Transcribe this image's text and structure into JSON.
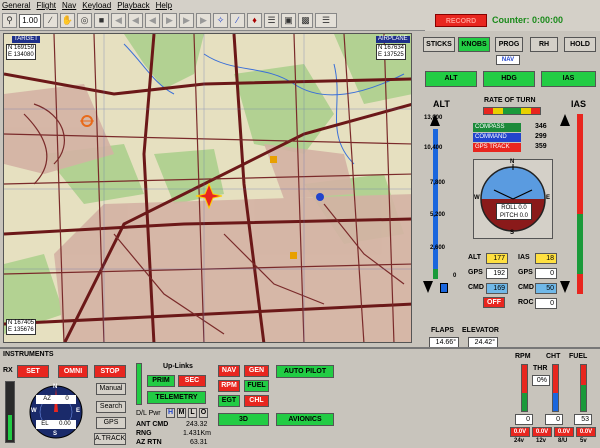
{
  "menu": [
    "General",
    "Flight",
    "Nav",
    "Keyload",
    "Playback",
    "Help"
  ],
  "toolbar": {
    "zoom": "1.00"
  },
  "topright": {
    "record_label": "RECORD",
    "counter": "Counter: 0:00:00"
  },
  "map": {
    "target_label": "TARGET",
    "target_n": "N 169159",
    "target_e": "E 134080",
    "airplane_label": "AIRPLANE",
    "airplane_n": "N 167634",
    "airplane_e": "E 137525",
    "cursor_n": "N 167405",
    "cursor_e": "E 135676"
  },
  "mode_buttons": {
    "sticks": "STICKS",
    "knobs": "KNOBS",
    "prog": "PROG",
    "rh": "RH",
    "hold": "HOLD",
    "nav": "NAV",
    "alt": "ALT",
    "hdg": "HDG",
    "ias": "IAS"
  },
  "alt_gauge": {
    "label": "ALT",
    "ticks": [
      "13,000",
      "10,400",
      "7,800",
      "5,200",
      "2,600",
      "0"
    ]
  },
  "ias_gauge": {
    "label": "IAS"
  },
  "turn": {
    "label": "RATE OF TURN"
  },
  "headings": [
    {
      "name": "COMPASS",
      "value": "346",
      "color": "#1c8a3a"
    },
    {
      "name": "COMMAND",
      "value": "299",
      "color": "#2244cc"
    },
    {
      "name": "GPS TRACK",
      "value": "359",
      "color": "#d22"
    }
  ],
  "attitude": {
    "roll": "ROLL 0.0",
    "pitch": "PITCH 0.0",
    "n": "N",
    "e": "E",
    "w": "W",
    "s": "S"
  },
  "readouts": {
    "alt_l": "ALT",
    "alt_v": "177",
    "ias_l": "IAS",
    "ias_v": "18",
    "gps1_l": "GPS",
    "gps1_v": "192",
    "gps2_l": "GPS",
    "gps2_v": "0",
    "cmd1_l": "CMD",
    "cmd1_v": "169",
    "cmd2_l": "CMD",
    "cmd2_v": "50",
    "off": "OFF",
    "roc_l": "ROC",
    "roc_v": "0"
  },
  "flaps": {
    "label": "FLAPS",
    "value": "14.66°"
  },
  "elevator": {
    "label": "ELEVATOR",
    "value": "24.42°"
  },
  "instruments": {
    "title": "INSTRUMENTS",
    "rx": "RX",
    "set": "SET",
    "omni": "OMNI",
    "stop": "STOP",
    "az": "AZ",
    "az_v": "0",
    "el": "EL",
    "el_v": "0.00",
    "n": "N",
    "s": "S",
    "w": "W",
    "e": "E",
    "manual": "Manual",
    "search": "Search",
    "gps": "GPS",
    "atrack": "A.TRACK",
    "uplinks": "Up-Links",
    "prim": "PRIM",
    "sec": "SEC",
    "telemetry": "TELEMETRY",
    "dl_pwr": "D/L Pwr",
    "h": "H",
    "m": "M",
    "l": "L",
    "o": "O",
    "ant_cmd": "ANT CMD",
    "ant_cmd_v": "243.32",
    "rng": "RNG",
    "rng_v": "1.431Km",
    "az_rtn": "AZ RTN",
    "az_rtn_v": "63.31",
    "nav": "NAV",
    "gen": "GEN",
    "rpm": "RPM",
    "fuel": "FUEL",
    "egt": "EGT",
    "chl": "CHL",
    "autopilot": "AUTO PILOT",
    "ip": "3D",
    "avionics": "AVIONICS"
  },
  "engine": {
    "rpm": "RPM",
    "cht": "CHT",
    "fuel": "FUEL",
    "thr": "THR",
    "thr_v": "0%",
    "rpm_v": "0",
    "cht_v": "0",
    "fuel_v": "53",
    "v1": "0.0V",
    "v2": "0.0V",
    "v3": "0.0V",
    "v4": "0.0V",
    "l1": "24v",
    "l2": "12v",
    "l3": "8/U",
    "l4": "5v"
  }
}
